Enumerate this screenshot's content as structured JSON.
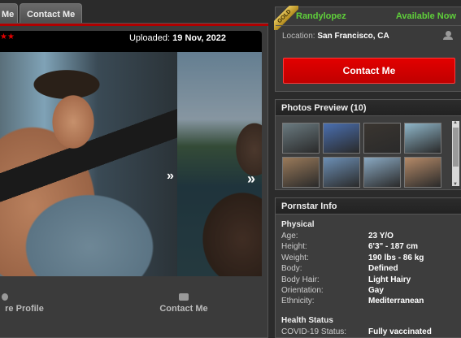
{
  "tabs": [
    {
      "label": "Me"
    },
    {
      "label": "Contact Me"
    }
  ],
  "photo_bar": {
    "stars": "★★",
    "uploaded_label": "Uploaded:",
    "uploaded_date": "19 Nov, 2022",
    "next_glyph": "»"
  },
  "actions": {
    "profile_label": "re Profile",
    "contact_label": "Contact Me"
  },
  "model_card": {
    "badge": "GOLD",
    "name": "Randylopez",
    "availability": "Available Now",
    "location_label": "Location:",
    "location_value": "San Francisco, CA",
    "contact_button": "Contact Me"
  },
  "photos_preview": {
    "title": "Photos Preview (10)",
    "thumbs": [
      {
        "color": "#6a7a80"
      },
      {
        "color": "#4a6fb0"
      },
      {
        "color": "#3a3530"
      },
      {
        "color": "#8fb6c9"
      },
      {
        "color": "#9a7a5a"
      },
      {
        "color": "#6c8fb5"
      },
      {
        "color": "#8aa9c2"
      },
      {
        "color": "#b58a68"
      }
    ]
  },
  "info": {
    "title": "Pornstar Info",
    "physical_title": "Physical",
    "rows": [
      {
        "k": "Age:",
        "v": "23 Y/O"
      },
      {
        "k": "Height:",
        "v": "6'3\" - 187 cm"
      },
      {
        "k": "Weight:",
        "v": "190 lbs - 86 kg"
      },
      {
        "k": "Body:",
        "v": "Defined"
      },
      {
        "k": "Body Hair:",
        "v": "Light Hairy"
      },
      {
        "k": "Orientation:",
        "v": "Gay"
      },
      {
        "k": "Ethnicity:",
        "v": "Mediterranean"
      }
    ],
    "health_title": "Health Status",
    "covid_label": "COVID-19 Status:",
    "covid_value": "Fully vaccinated"
  },
  "colors": {
    "accent_red": "#e20000",
    "available_green": "#5fcf3a",
    "gold": "#e4c45a"
  }
}
